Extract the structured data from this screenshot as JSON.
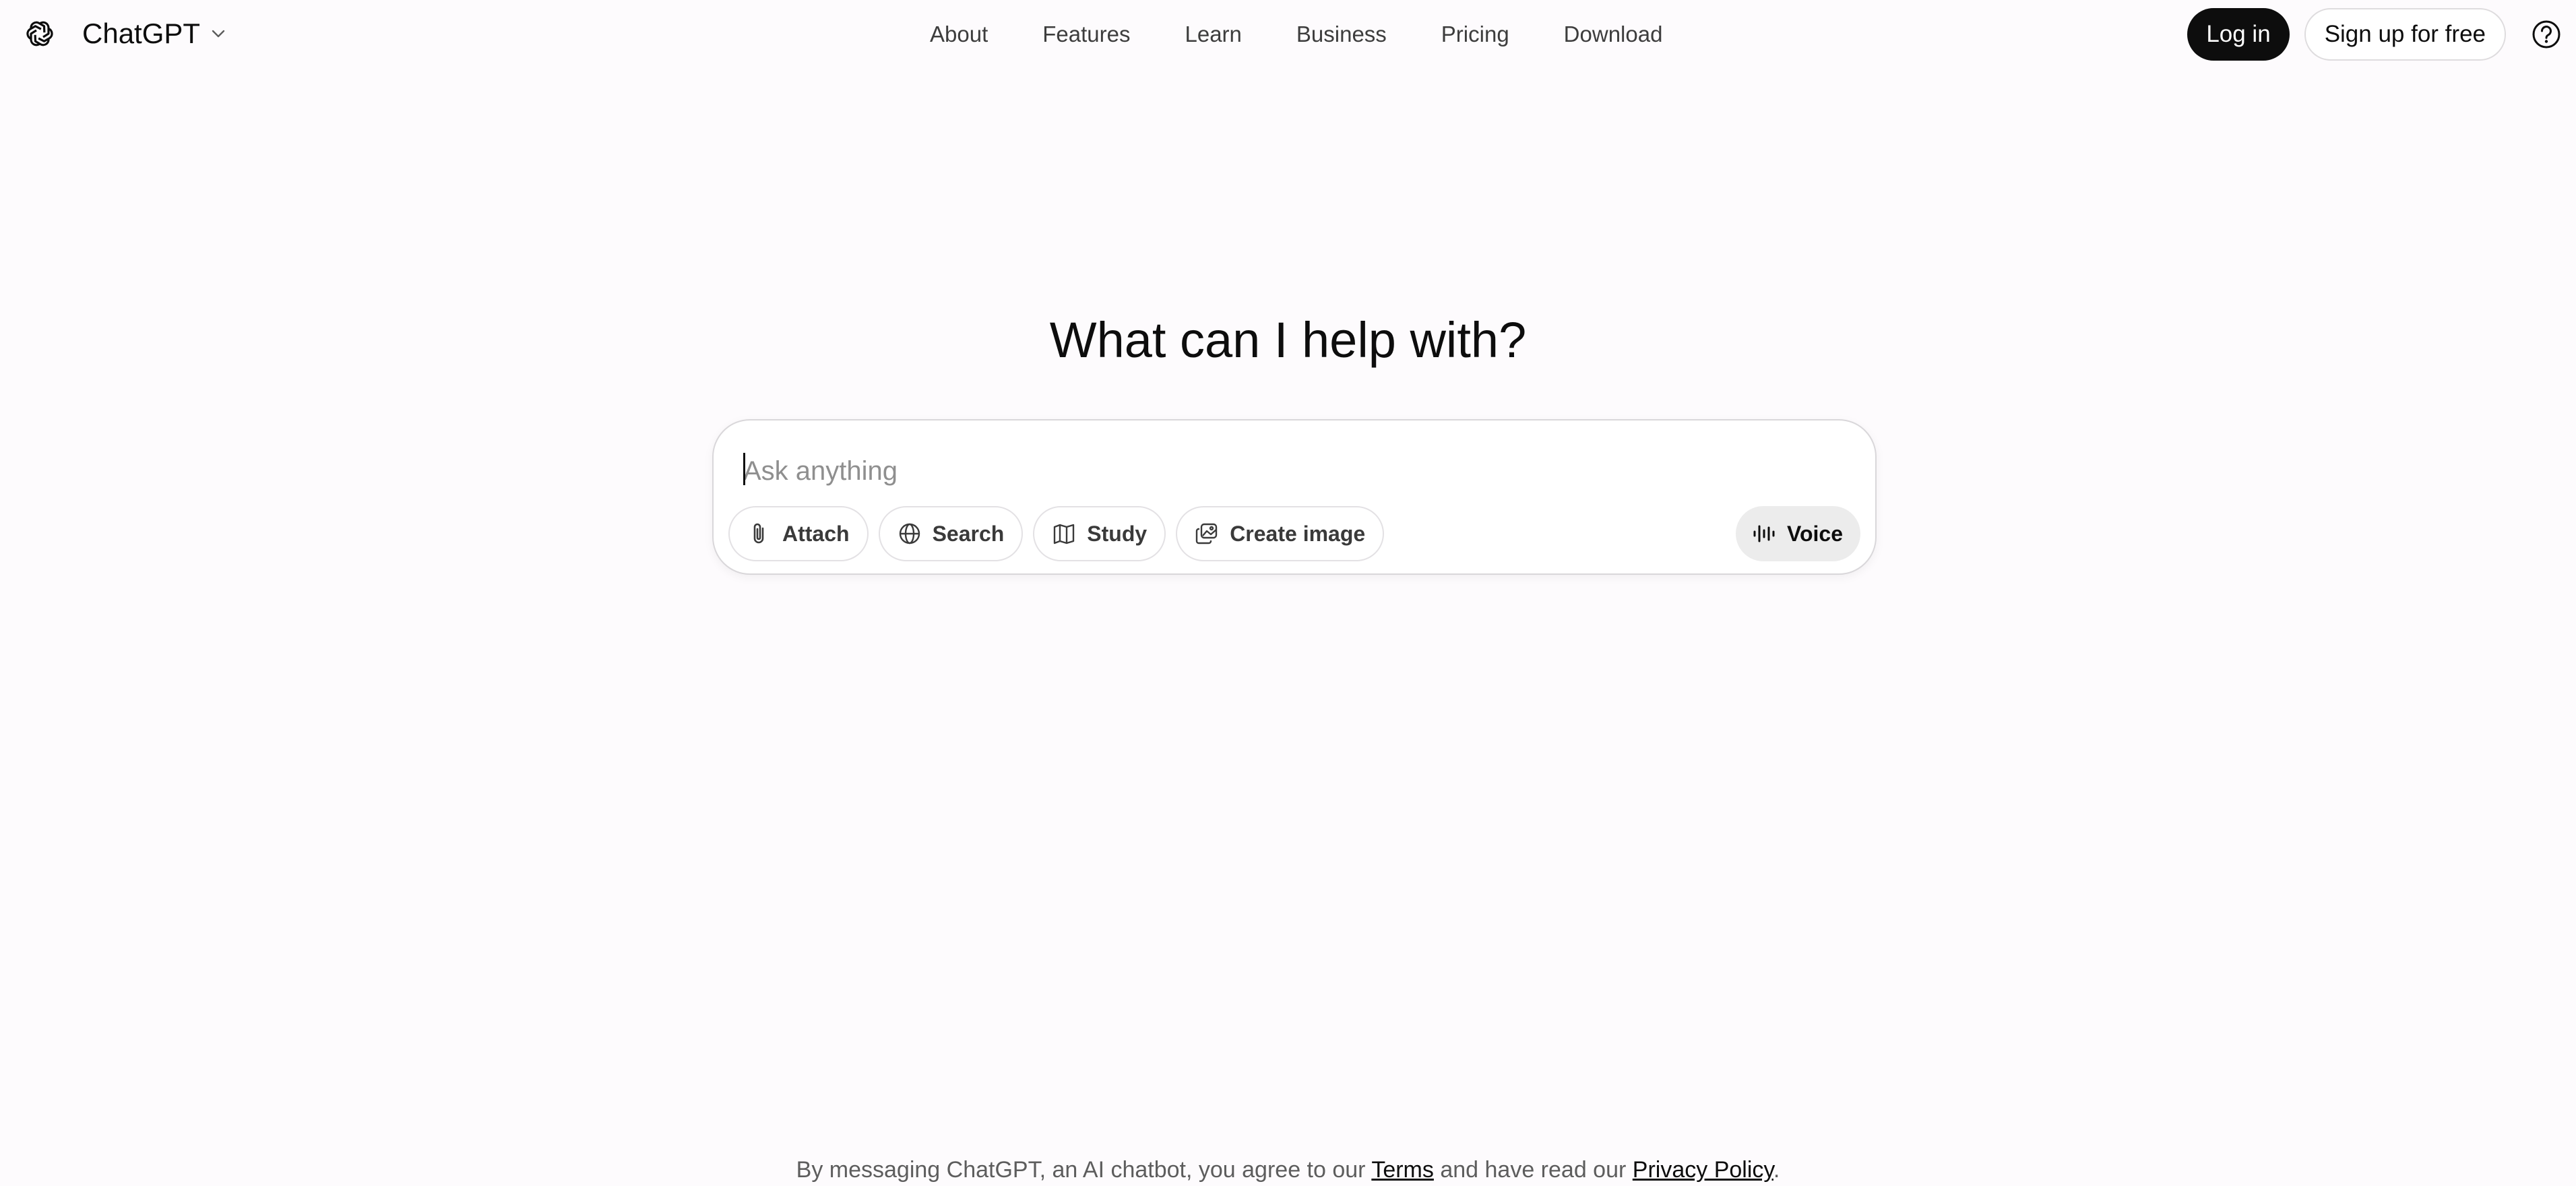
{
  "header": {
    "brand": "ChatGPT",
    "nav": [
      "About",
      "Features",
      "Learn",
      "Business",
      "Pricing",
      "Download"
    ],
    "login_label": "Log in",
    "signup_label": "Sign up for free"
  },
  "main": {
    "title": "What can I help with?",
    "composer": {
      "placeholder": "Ask anything",
      "value": "",
      "tools": [
        {
          "label": "Attach",
          "icon": "paperclip-icon"
        },
        {
          "label": "Search",
          "icon": "globe-icon"
        },
        {
          "label": "Study",
          "icon": "book-icon"
        },
        {
          "label": "Create image",
          "icon": "image-icon"
        }
      ],
      "voice_label": "Voice",
      "voice_icon": "waveform-icon"
    }
  },
  "footer": {
    "text_before": "By messaging ChatGPT, an AI chatbot, you agree to our ",
    "terms_label": "Terms",
    "text_middle": " and have read our ",
    "privacy_label": "Privacy Policy",
    "text_after": "."
  },
  "colors": {
    "background": "#fdfbfd",
    "primary_button": "#0d0d0d",
    "voice_button": "#ececec",
    "border": "#d9d7da"
  }
}
